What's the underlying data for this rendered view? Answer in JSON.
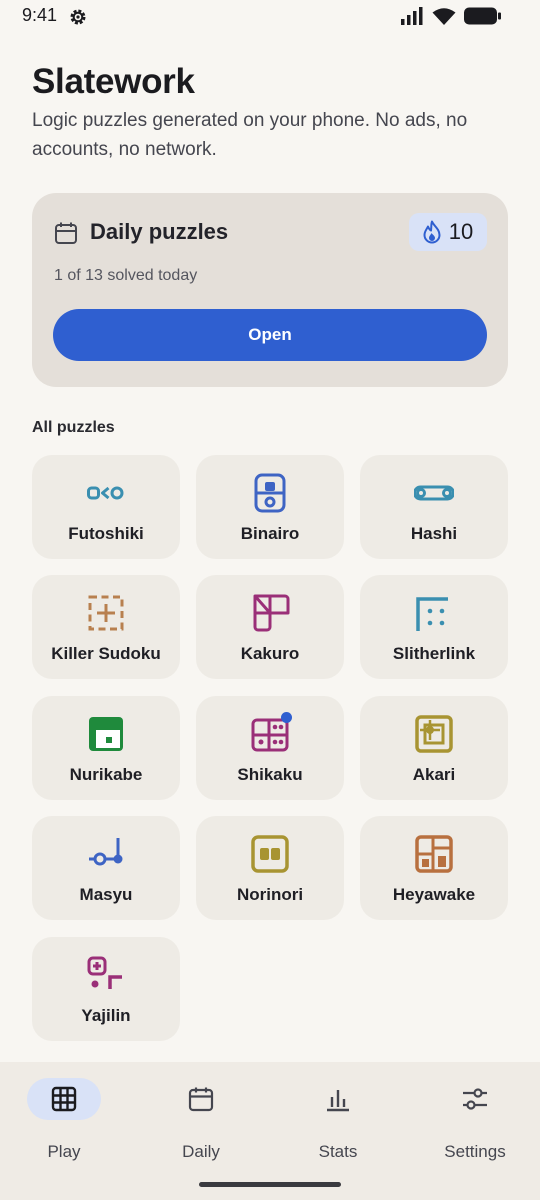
{
  "status_bar": {
    "time": "9:41",
    "icons": [
      "settings-gear-icon",
      "signal-icon",
      "wifi-icon",
      "battery-icon"
    ]
  },
  "header": {
    "title": "Slatework",
    "subtitle": "Logic puzzles generated on your phone. No ads, no accounts, no network."
  },
  "daily_card": {
    "icon": "calendar-icon",
    "title": "Daily puzzles",
    "streak_icon": "flame-icon",
    "streak_count": "10",
    "progress": "1 of 13 solved today",
    "open_label": "Open"
  },
  "puzzles": {
    "section_label": "All puzzles",
    "items": [
      {
        "label": "Futoshiki",
        "icon": "futoshiki-icon",
        "color": "#3a8fb0"
      },
      {
        "label": "Binairo",
        "icon": "binairo-icon",
        "color": "#3e64c4"
      },
      {
        "label": "Hashi",
        "icon": "hashi-icon",
        "color": "#3a8fb0"
      },
      {
        "label": "Killer Sudoku",
        "icon": "killer-sudoku-icon",
        "color": "#b8804f"
      },
      {
        "label": "Kakuro",
        "icon": "kakuro-icon",
        "color": "#9a2f78"
      },
      {
        "label": "Slitherlink",
        "icon": "slitherlink-icon",
        "color": "#3a8fb0"
      },
      {
        "label": "Nurikabe",
        "icon": "nurikabe-icon",
        "color": "#1f8a3c"
      },
      {
        "label": "Shikaku",
        "icon": "shikaku-icon",
        "color": "#9a2f78",
        "has_dot": true
      },
      {
        "label": "Akari",
        "icon": "akari-icon",
        "color": "#a89432"
      },
      {
        "label": "Masyu",
        "icon": "masyu-icon",
        "color": "#3e64c4"
      },
      {
        "label": "Norinori",
        "icon": "norinori-icon",
        "color": "#a89432"
      },
      {
        "label": "Heyawake",
        "icon": "heyawake-icon",
        "color": "#b8703f"
      },
      {
        "label": "Yajilin",
        "icon": "yajilin-icon",
        "color": "#9a2f78"
      }
    ]
  },
  "bottom_nav": {
    "items": [
      {
        "label": "Play",
        "icon": "grid-icon",
        "active": true
      },
      {
        "label": "Daily",
        "icon": "calendar-icon",
        "active": false
      },
      {
        "label": "Stats",
        "icon": "bar-chart-icon",
        "active": false
      },
      {
        "label": "Settings",
        "icon": "sliders-icon",
        "active": false
      }
    ]
  },
  "colors": {
    "accent": "#2f5fd0",
    "background": "#f8f6f2",
    "card": "#e4dfd9",
    "tile": "#eeebe5",
    "badge": "#d9e2f7"
  }
}
